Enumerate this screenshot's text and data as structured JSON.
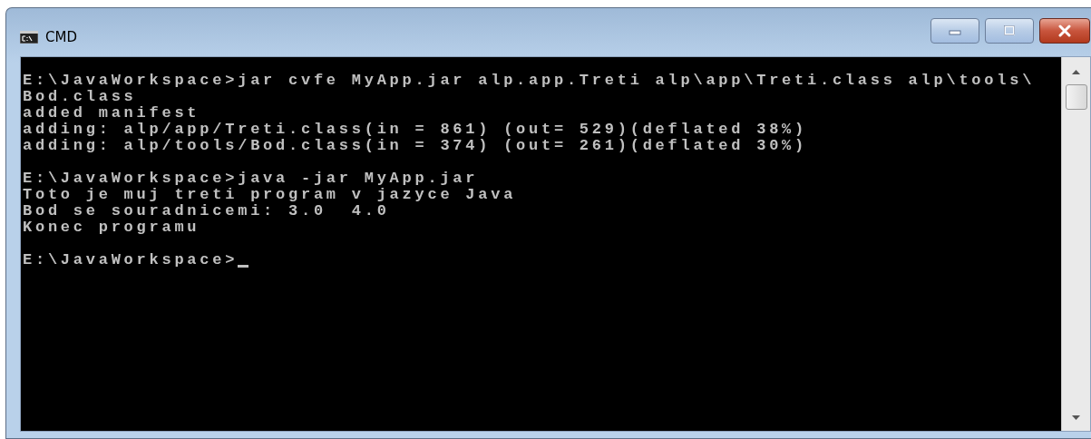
{
  "window": {
    "title": "CMD"
  },
  "console": {
    "blocks": [
      [
        "E:\\JavaWorkspace>jar cvfe MyApp.jar alp.app.Treti alp\\app\\Treti.class alp\\tools\\",
        "Bod.class",
        "added manifest",
        "adding: alp/app/Treti.class(in = 861) (out= 529)(deflated 38%)",
        "adding: alp/tools/Bod.class(in = 374) (out= 261)(deflated 30%)"
      ],
      [
        "E:\\JavaWorkspace>java -jar MyApp.jar",
        "Toto je muj treti program v jazyce Java",
        "Bod se souradnicemi: 3.0  4.0",
        "Konec programu"
      ],
      [
        "E:\\JavaWorkspace>"
      ]
    ]
  }
}
